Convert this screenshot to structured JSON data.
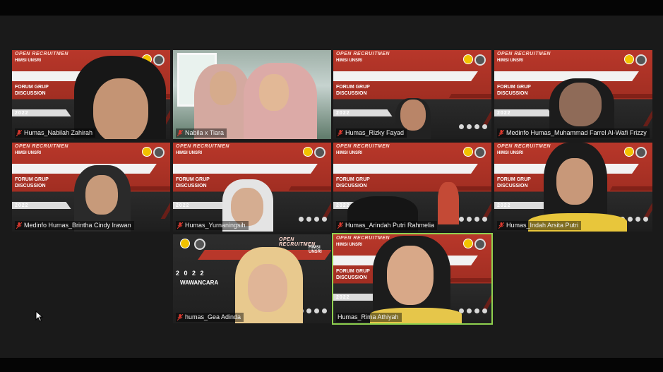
{
  "meeting": {
    "participants": [
      {
        "name": "Humas_Nabilah Zahirah",
        "mic_icon": "mic-muted-icon"
      },
      {
        "name": "Nabila x Tiara",
        "mic_icon": "mic-muted-icon"
      },
      {
        "name": "Humas_Rizky Fayad",
        "mic_icon": "mic-muted-icon"
      },
      {
        "name": "Medinfo Humas_Muhammad Farrel Al-Wafi Frizzy",
        "mic_icon": "mic-muted-icon"
      },
      {
        "name": "Medinfo Humas_Brintha Cindy Irawan",
        "mic_icon": "mic-muted-icon"
      },
      {
        "name": "Humas_Yurnaningsih",
        "mic_icon": "mic-muted-icon"
      },
      {
        "name": "Humas_Arindah Putri Rahmelia",
        "mic_icon": "mic-muted-icon"
      },
      {
        "name": "Humas_Indah Arsita Putri",
        "mic_icon": "mic-muted-icon"
      },
      {
        "name": "humas_Gea Adinda",
        "mic_icon": "mic-muted-icon"
      },
      {
        "name": "Humas_Rima Athiyah",
        "active_speaker": true
      }
    ],
    "background": {
      "recruit": "OPEN RECRUITMEN",
      "org": "HIMSI UNSRI",
      "session": "FORUM GRUP DISCUSSION",
      "year": "2022",
      "interview": "WAWANCARA",
      "year_spaced": "2 0 2 2"
    },
    "colors": {
      "active_border": "#8fd14f",
      "brand_red": "#b8372a",
      "muted_mic": "#e03a2f"
    }
  }
}
